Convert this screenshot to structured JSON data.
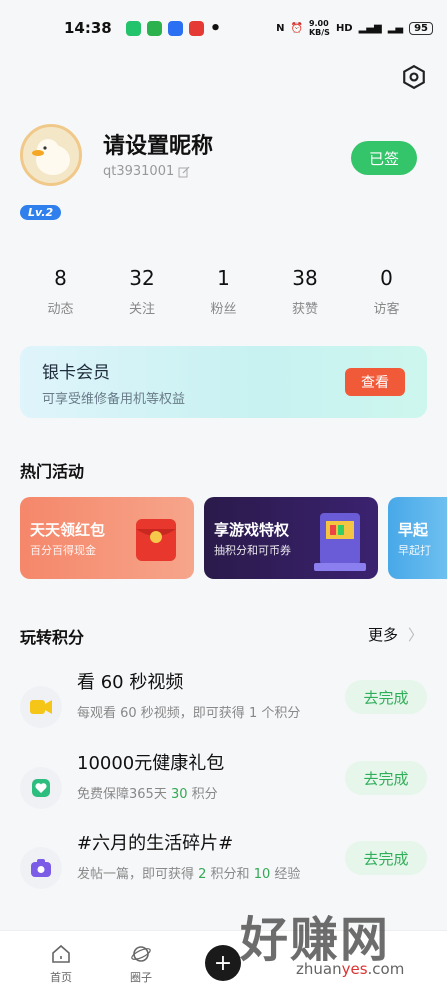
{
  "status_bar": {
    "time": "14:38",
    "net_speed": "9.00\nKB/S",
    "battery": "95"
  },
  "profile": {
    "nickname": "请设置昵称",
    "user_id": "qt3931001",
    "sign_label": "已签",
    "level": "Lv.2"
  },
  "stats": [
    {
      "value": "8",
      "label": "动态"
    },
    {
      "value": "32",
      "label": "关注"
    },
    {
      "value": "1",
      "label": "粉丝"
    },
    {
      "value": "38",
      "label": "获赞"
    },
    {
      "value": "0",
      "label": "访客"
    }
  ],
  "vip": {
    "title": "银卡会员",
    "subtitle": "可享受维修备用机等权益",
    "button": "查看"
  },
  "hot": {
    "title": "热门活动",
    "banners": [
      {
        "title": "天天领红包",
        "subtitle": "百分百得现金"
      },
      {
        "title": "享游戏特权",
        "subtitle": "抽积分和可币券"
      },
      {
        "title": "早起",
        "subtitle": "早起打"
      }
    ]
  },
  "points": {
    "title": "玩转积分",
    "more": "更多",
    "tasks": [
      {
        "title": "看 60 秒视频",
        "desc_a": "每观看 60 秒视频，即可获得 1 个积分",
        "button": "去完成"
      },
      {
        "title": "10000元健康礼包",
        "desc_a": "免费保障365天 ",
        "desc_num": "30",
        "desc_b": " 积分",
        "button": "去完成"
      },
      {
        "title": "#六月的生活碎片#",
        "desc_a": "发帖一篇，即可获得 ",
        "desc_num": "2",
        "desc_b": " 积分和 ",
        "desc_num2": "10",
        "desc_c": " 经验",
        "button": "去完成"
      }
    ]
  },
  "tabbar": {
    "home": "首页",
    "circle": "圈子",
    "add": "+"
  },
  "watermark": {
    "big": "好赚网",
    "url_a": "zhuan",
    "url_b": "yes",
    "url_c": ".com"
  },
  "colors": {
    "green": "#34c46a",
    "accent_red": "#f15a38",
    "level_blue": "#2f80ed"
  }
}
